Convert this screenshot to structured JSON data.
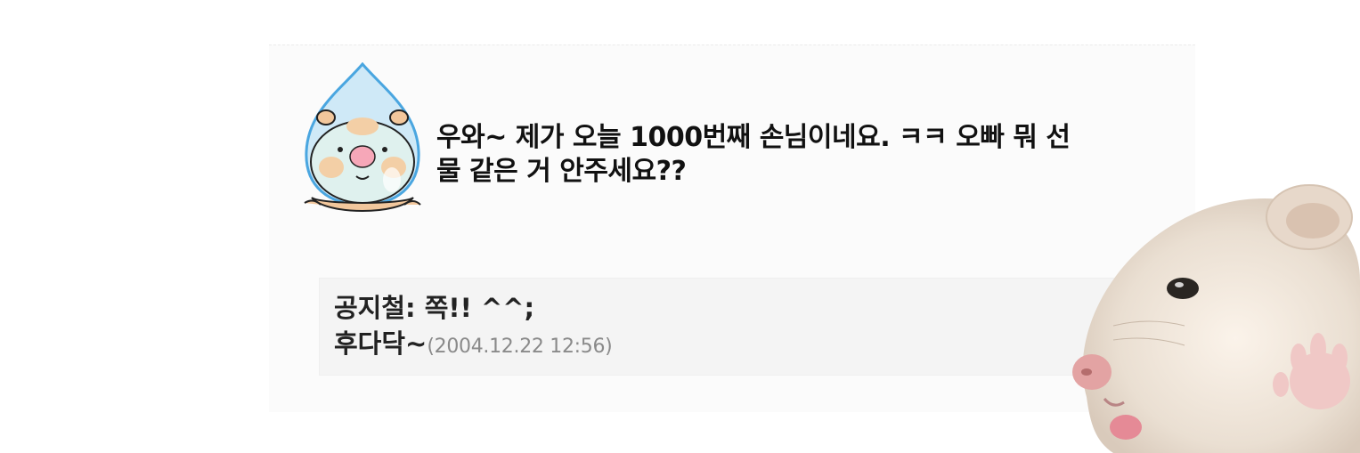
{
  "post": {
    "avatar_icon": "hamster-raindrop-icon",
    "message_line1": "우와~ 제가 오늘 1000번째 손님이네요. ㅋㅋ 오빠 뭐 선",
    "message_line2": "물 같은 거 안주세요??"
  },
  "reply": {
    "author_text": "공지철: 쪽!! ^^;",
    "text": "후다닥~",
    "date": "(2004.12.22 12:56)"
  },
  "decoration": {
    "photo_icon": "hamster-photo-icon"
  },
  "colors": {
    "panel_bg": "#fbfbfb",
    "reply_bg": "#f4f4f4",
    "raindrop_blue": "#5ab4e8",
    "text": "#111111",
    "date_gray": "#8a8a8a"
  }
}
